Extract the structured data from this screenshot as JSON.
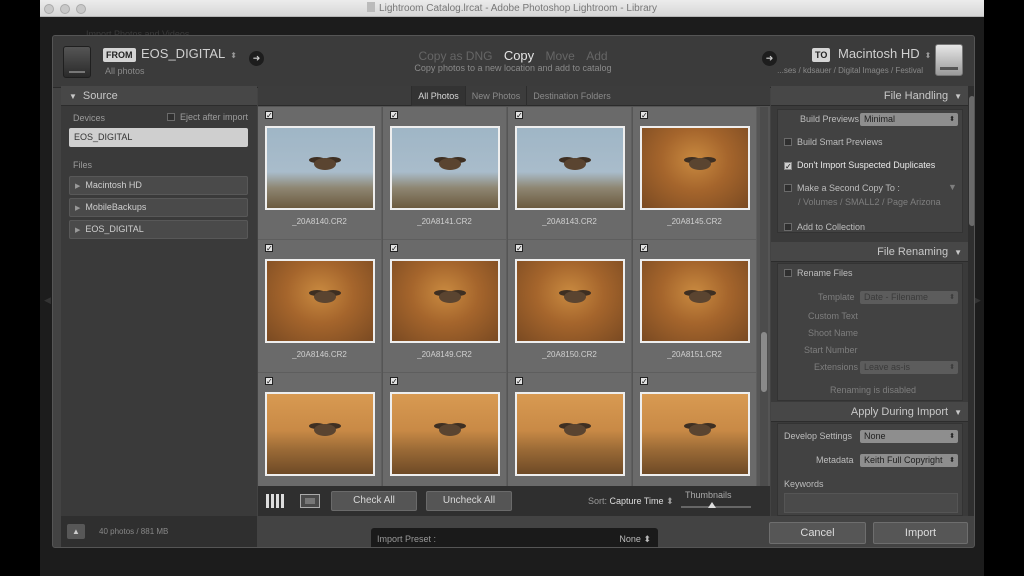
{
  "window": {
    "title": "Lightroom Catalog.lrcat - Adobe Photoshop Lightroom - Library",
    "background_hint": "Import Photos and Videos"
  },
  "header": {
    "from_label": "FROM",
    "source_name": "EOS_DIGITAL",
    "source_sub": "All photos",
    "modes": [
      "Copy as DNG",
      "Copy",
      "Move",
      "Add"
    ],
    "active_mode": "Copy",
    "mode_description": "Copy photos to a new location and add to catalog",
    "to_label": "TO",
    "dest_name": "Macintosh HD",
    "dest_path": "...ses / kdsauer / Digital Images / Festival"
  },
  "source_panel": {
    "title": "Source",
    "devices_label": "Devices",
    "eject_label": "Eject after import",
    "device": "EOS_DIGITAL",
    "files_label": "Files",
    "files": [
      "Macintosh HD",
      "MobileBackups",
      "EOS_DIGITAL"
    ]
  },
  "center": {
    "tabs": [
      "All Photos",
      "New Photos",
      "Destination Folders"
    ],
    "photos": [
      {
        "name": "_20A8140.CR2",
        "scene": "sky"
      },
      {
        "name": "_20A8141.CR2",
        "scene": "sky"
      },
      {
        "name": "_20A8143.CR2",
        "scene": "sky"
      },
      {
        "name": "_20A8145.CR2",
        "scene": "brush"
      },
      {
        "name": "_20A8146.CR2",
        "scene": "brush"
      },
      {
        "name": "_20A8149.CR2",
        "scene": "brush"
      },
      {
        "name": "_20A8150.CR2",
        "scene": "brush"
      },
      {
        "name": "_20A8151.CR2",
        "scene": "brush"
      },
      {
        "name": "",
        "scene": "field"
      },
      {
        "name": "",
        "scene": "field"
      },
      {
        "name": "",
        "scene": "field"
      },
      {
        "name": "",
        "scene": "field"
      }
    ],
    "check_all": "Check All",
    "uncheck_all": "Uncheck All",
    "sort_label": "Sort:",
    "sort_value": "Capture Time",
    "thumbnails_label": "Thumbnails"
  },
  "right_panel": {
    "file_handling": {
      "title": "File Handling",
      "build_previews_label": "Build Previews",
      "build_previews_value": "Minimal",
      "smart_previews": "Build Smart Previews",
      "dont_import_dupes": "Don't Import Suspected Duplicates",
      "second_copy": "Make a Second Copy To :",
      "second_copy_path": "/ Volumes / SMALL2 / Page Arizona",
      "add_collection": "Add to Collection"
    },
    "file_renaming": {
      "title": "File Renaming",
      "rename_files": "Rename Files",
      "template_label": "Template",
      "template_value": "Date - Filename",
      "custom_text": "Custom Text",
      "shoot_name": "Shoot Name",
      "start_number": "Start Number",
      "extensions_label": "Extensions",
      "extensions_value": "Leave as-is",
      "renaming_disabled": "Renaming is disabled"
    },
    "apply": {
      "title": "Apply During Import",
      "develop_label": "Develop Settings",
      "develop_value": "None",
      "metadata_label": "Metadata",
      "metadata_value": "Keith Full Copyright",
      "keywords_label": "Keywords"
    }
  },
  "footer": {
    "count": "40 photos / 881 MB",
    "preset_label": "Import Preset :",
    "preset_value": "None",
    "cancel": "Cancel",
    "import": "Import"
  },
  "colors": {
    "dialog_bg": "#434343",
    "panel_bg": "#3a3a3a",
    "grid_cell": "#6a6a6a",
    "text_light": "#d0d0d0"
  }
}
